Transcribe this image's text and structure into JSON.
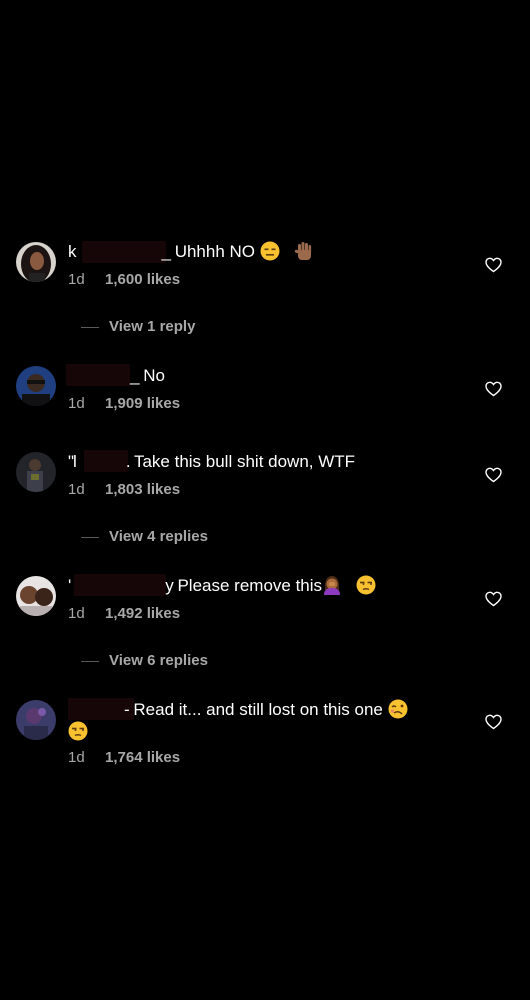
{
  "colors": {
    "background": "#000000",
    "text": "#ffffff",
    "meta": "#a8a8a8",
    "redaction": "#170607"
  },
  "comments": [
    {
      "username": "k",
      "user_suffix": "_",
      "text": " Uhhhh NO ",
      "emojis": [
        "expressionless-face",
        "raised-hand"
      ],
      "time": "1d",
      "likes": "1,600 likes",
      "view_replies": "View 1 reply"
    },
    {
      "username": "",
      "user_suffix": "_",
      "text": " No",
      "emojis": [],
      "time": "1d",
      "likes": "1,909 likes",
      "view_replies": ""
    },
    {
      "username": "\"l",
      "user_suffix": ".",
      "text": " Take this bull shit down, WTF",
      "emojis": [],
      "time": "1d",
      "likes": "1,803 likes",
      "view_replies": "View 4 replies"
    },
    {
      "username": "'",
      "user_suffix": "y",
      "text": " Please remove this",
      "emojis": [
        "woman-facepalming",
        "unamused-face"
      ],
      "time": "1d",
      "likes": "1,492 likes",
      "view_replies": "View 6 replies"
    },
    {
      "username": "",
      "user_suffix": "-",
      "text": " Read it... and still lost on this one ",
      "emojis": [
        "woozy-face",
        "unamused-face"
      ],
      "time": "1d",
      "likes": "1,764 likes",
      "view_replies": ""
    }
  ]
}
